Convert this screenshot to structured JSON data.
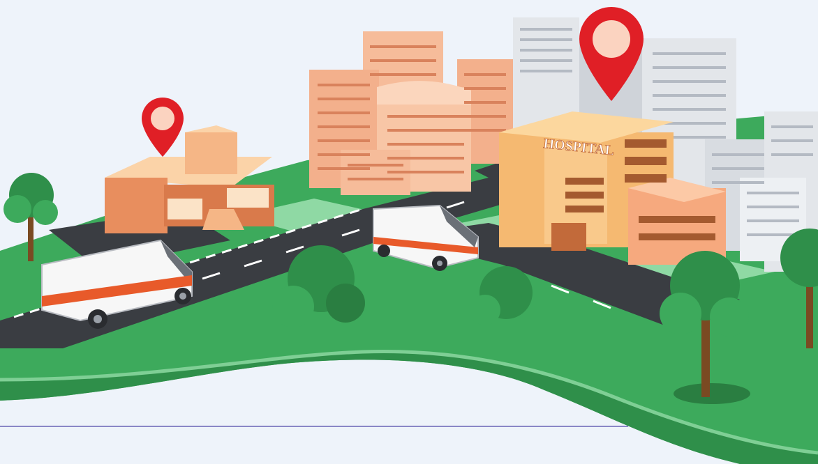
{
  "scene": {
    "hospital_sign": "HOSPITAL",
    "colors": {
      "background": "#eef3fa",
      "grass": "#3daa5c",
      "grass_dark": "#2f8f4a",
      "grass_light": "#7fcf95",
      "road": "#3a3d42",
      "building_peach": "#f3b08c",
      "building_gray": "#e3e6ea",
      "hospital": "#f5b971",
      "pin_red": "#e01f26",
      "ambulance_stripe": "#e85a2a",
      "divider": "#8a87c7"
    },
    "icons": [
      "location-pin-icon",
      "location-pin-icon"
    ]
  }
}
